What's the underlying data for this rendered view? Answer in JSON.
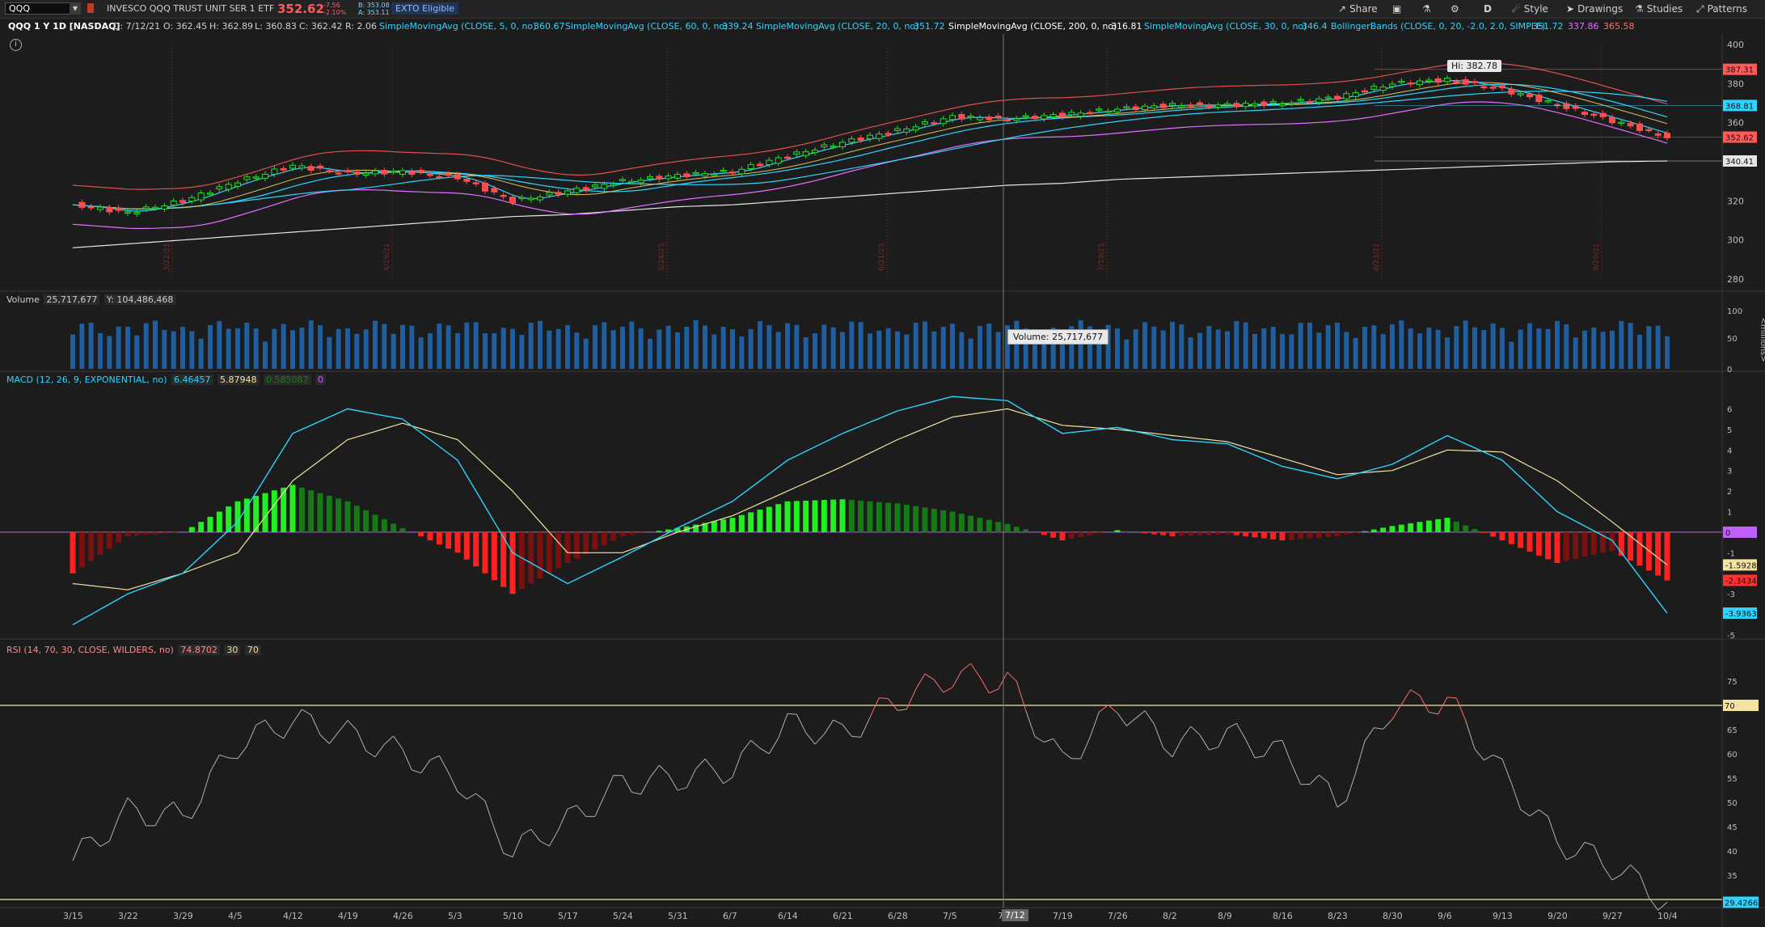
{
  "topbar": {
    "symbol": "QQQ",
    "instrument_name": "INVESCO QQQ TRUST UNIT SER 1 ETF",
    "last_price": "352.62",
    "change": "-7.56",
    "change_pct": "-2.10%",
    "bid": "B: 353.08",
    "ask": "A: 353.11",
    "ext_badge": "EXTO Eligible",
    "tools": {
      "share": "Share",
      "period": "D",
      "style": "Style",
      "drawings": "Drawings",
      "studies": "Studies",
      "patterns": "Patterns"
    }
  },
  "studybar": {
    "title": "QQQ 1 Y 1D [NASDAQ]",
    "date": "D: 7/12/21",
    "open": "O: 362.45",
    "high": "H: 362.89",
    "low": "L: 360.83",
    "close": "C: 362.42",
    "range": "R: 2.06",
    "sma5_label": "SimpleMovingAvg (CLOSE, 5, 0, no)",
    "sma5_value": "360.67",
    "sma60_label": "SimpleMovingAvg (CLOSE, 60, 0, no)",
    "sma60_value": "339.24",
    "sma20_label": "SimpleMovingAvg (CLOSE, 20, 0, no)",
    "sma20_value": "351.72",
    "sma200_label": "SimpleMovingAvg (CLOSE, 200, 0, no)",
    "sma200_value": "316.81",
    "sma30_label": "SimpleMovingAvg (CLOSE, 30, 0, no)",
    "sma30_value": "346.4",
    "bb_label": "BollingerBands (CLOSE, 0, 20, -2.0, 2.0, SIMPLE)",
    "bb_mid": "351.72",
    "bb_low": "337.86",
    "bb_up": "365.58"
  },
  "price_panel": {
    "hi_label": "Hi: 382.78",
    "y_ticks": [
      "400",
      "380",
      "360",
      "340",
      "320",
      "300",
      "280"
    ],
    "price_tags": [
      {
        "text": "387.31",
        "color": "#ff5a5a"
      },
      {
        "text": "368.81",
        "color": "#2fd3ff"
      },
      {
        "text": "352.62",
        "color": "#ff5a5a"
      },
      {
        "text": "340.41",
        "color": "#e6e6e6"
      }
    ],
    "vertical_date_labels": [
      "3/22/21",
      "4/19/21",
      "5/24/21",
      "6/21/21",
      "7/19/21",
      "8/23/21",
      "9/20/21"
    ]
  },
  "volume_panel": {
    "label": "Volume",
    "value": "25,717,677",
    "y_value": "Y: 104,486,468",
    "tooltip": "Volume: 25,717,677",
    "y_ticks": [
      "100",
      "50",
      "0"
    ],
    "unit": "<millions>"
  },
  "macd_panel": {
    "label": "MACD (12, 26, 9, EXPONENTIAL, no)",
    "value": "6.46457",
    "avg": "5.87948",
    "diff": "0.585087",
    "zero": "0",
    "y_ticks": [
      "6",
      "5",
      "4",
      "3",
      "2",
      "1",
      "-1",
      "-3",
      "-5"
    ],
    "tags": [
      {
        "text": "0",
        "color": "#c060ff"
      },
      {
        "text": "-1.5928",
        "color": "#f3e2a0"
      },
      {
        "text": "-2.3434",
        "color": "#ff3030"
      },
      {
        "text": "-3.9363",
        "color": "#2fd3ff"
      }
    ]
  },
  "rsi_panel": {
    "label": "RSI (14, 70, 30, CLOSE, WILDERS, no)",
    "value": "74.8702",
    "ob": "30",
    "os": "70",
    "y_ticks": [
      "75",
      "70",
      "65",
      "60",
      "55",
      "50",
      "45",
      "40",
      "35"
    ],
    "tags": [
      {
        "text": "70",
        "color": "#f3e2a0"
      },
      {
        "text": "29.4266",
        "color": "#2fd3ff"
      }
    ]
  },
  "x_axis": {
    "dates": [
      "3/15",
      "3/22",
      "3/29",
      "4/5",
      "4/12",
      "4/19",
      "4/26",
      "5/3",
      "5/10",
      "5/17",
      "5/24",
      "5/31",
      "6/7",
      "6/14",
      "6/21",
      "6/28",
      "7/5",
      "7/",
      "7/19",
      "7/26",
      "8/2",
      "8/9",
      "8/16",
      "8/23",
      "8/30",
      "9/6",
      "9/13",
      "9/20",
      "9/27",
      "10/4"
    ],
    "crosshair_date": "7/12"
  },
  "colors": {
    "up": "#22dd22",
    "down": "#ff4d4d",
    "sma_cyan": "#2fd3ff",
    "sma_white": "#e6e6e6",
    "bb_red": "#e05050",
    "bb_magenta": "#e070ff",
    "macd_line": "#2fd3ff",
    "macd_avg": "#f3e2a0",
    "rsi": "#b0b0b0",
    "rsi_ob": "#ff6a6a",
    "volume": "#1f5fa0"
  },
  "chart_data": [
    {
      "type": "line",
      "title": "QQQ 1 Y 1D [NASDAQ]",
      "x": [
        "3/15",
        "3/22",
        "3/29",
        "4/5",
        "4/12",
        "4/19",
        "4/26",
        "5/3",
        "5/10",
        "5/17",
        "5/24",
        "5/31",
        "6/7",
        "6/14",
        "6/21",
        "6/28",
        "7/5",
        "7/12",
        "7/19",
        "7/26",
        "8/2",
        "8/9",
        "8/16",
        "8/23",
        "8/30",
        "9/6",
        "9/13",
        "9/20",
        "9/27",
        "10/4"
      ],
      "series": [
        {
          "name": "Close",
          "values": [
            318,
            314,
            320,
            330,
            338,
            334,
            335,
            332,
            320,
            325,
            330,
            333,
            335,
            343,
            350,
            356,
            363,
            362,
            364,
            367,
            369,
            369,
            370,
            373,
            380,
            382,
            377,
            369,
            361,
            352.62
          ]
        },
        {
          "name": "SimpleMovingAvg (CLOSE, 200, 0, no)",
          "values": [
            296,
            298,
            300,
            302,
            304,
            306,
            308,
            310,
            312,
            313,
            315,
            317,
            318,
            320,
            322,
            324,
            326,
            328,
            329,
            331,
            332,
            333,
            334,
            335,
            336,
            337,
            338,
            339,
            340,
            340.41
          ]
        }
      ],
      "ylim": [
        280,
        400
      ]
    },
    {
      "type": "line",
      "title": "MACD (12, 26, 9, EXPONENTIAL, no)",
      "x": [
        "3/15",
        "3/22",
        "3/29",
        "4/5",
        "4/12",
        "4/19",
        "4/26",
        "5/3",
        "5/10",
        "5/17",
        "5/24",
        "5/31",
        "6/7",
        "6/14",
        "6/21",
        "6/28",
        "7/5",
        "7/12",
        "7/19",
        "7/26",
        "8/2",
        "8/9",
        "8/16",
        "8/23",
        "8/30",
        "9/6",
        "9/13",
        "9/20",
        "9/27",
        "10/4"
      ],
      "series": [
        {
          "name": "MACD",
          "values": [
            -4.5,
            -3,
            -2,
            0.5,
            4.8,
            6,
            5.5,
            3.5,
            -1,
            -2.5,
            -1.2,
            0.2,
            1.5,
            3.5,
            4.8,
            5.9,
            6.6,
            6.4,
            4.8,
            5.1,
            4.5,
            4.3,
            3.2,
            2.6,
            3.3,
            4.7,
            3.5,
            1.0,
            -0.4,
            -3.94
          ]
        },
        {
          "name": "MACD Avg",
          "values": [
            -2.5,
            -2.8,
            -2,
            -1,
            2.5,
            4.5,
            5.3,
            4.5,
            2,
            -1,
            -1,
            0,
            0.8,
            2,
            3.2,
            4.5,
            5.6,
            6.0,
            5.2,
            5.0,
            4.7,
            4.4,
            3.6,
            2.8,
            3.0,
            4.0,
            3.9,
            2.5,
            0.5,
            -1.59
          ]
        }
      ],
      "ylim": [
        -5,
        7
      ]
    },
    {
      "type": "line",
      "title": "RSI (14, 70, 30, CLOSE, WILDERS, no)",
      "x": [
        "3/15",
        "3/22",
        "3/29",
        "4/5",
        "4/12",
        "4/19",
        "4/26",
        "5/3",
        "5/10",
        "5/17",
        "5/24",
        "5/31",
        "6/7",
        "6/14",
        "6/21",
        "6/28",
        "7/5",
        "7/12",
        "7/19",
        "7/26",
        "8/2",
        "8/9",
        "8/16",
        "8/23",
        "8/30",
        "9/6",
        "9/13",
        "9/20",
        "9/27",
        "10/4"
      ],
      "series": [
        {
          "name": "RSI",
          "values": [
            38,
            48,
            47,
            62,
            67,
            64,
            60,
            55,
            40,
            46,
            54,
            55,
            57,
            66,
            64,
            71,
            76,
            75,
            58,
            70,
            62,
            64,
            60,
            50,
            70,
            71,
            56,
            42,
            37,
            29.43
          ]
        }
      ],
      "ylim": [
        30,
        80
      ]
    }
  ]
}
